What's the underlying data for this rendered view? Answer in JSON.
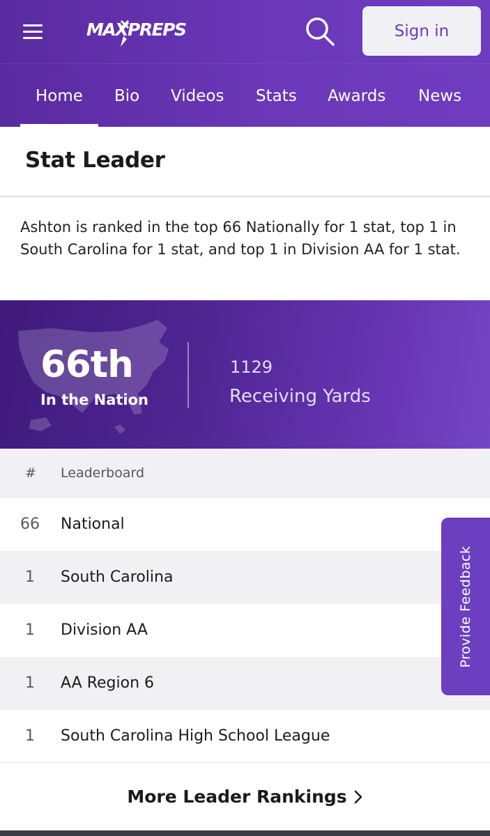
{
  "header": {
    "logo_text": "MAXPREPS",
    "menu_icon": "hamburger-menu-icon",
    "search_icon": "search-icon",
    "signin_label": "Sign in",
    "brand_color": "#6a38b8"
  },
  "tabs": [
    {
      "label": "Home",
      "active": true
    },
    {
      "label": "Bio"
    },
    {
      "label": "Videos"
    },
    {
      "label": "Stats"
    },
    {
      "label": "Awards"
    },
    {
      "label": "News"
    }
  ],
  "section": {
    "title": "Stat Leader",
    "summary": "Ashton is ranked in the top 66 Nationally for 1 stat, top 1 in South Carolina for 1 stat, and top 1 in Division AA for 1 stat."
  },
  "hero": {
    "rank": "66th",
    "rank_scope": "In the Nation",
    "stat_value": "1129",
    "stat_name": "Receiving Yards"
  },
  "leaderboard": {
    "col_rank": "#",
    "col_name": "Leaderboard",
    "rows": [
      {
        "rank": "66",
        "name": "National"
      },
      {
        "rank": "1",
        "name": "South Carolina"
      },
      {
        "rank": "1",
        "name": "Division AA"
      },
      {
        "rank": "1",
        "name": "AA Region 6"
      },
      {
        "rank": "1",
        "name": "South Carolina High School League"
      }
    ]
  },
  "more_link": "More Leader Rankings",
  "feedback_label": "Provide Feedback"
}
